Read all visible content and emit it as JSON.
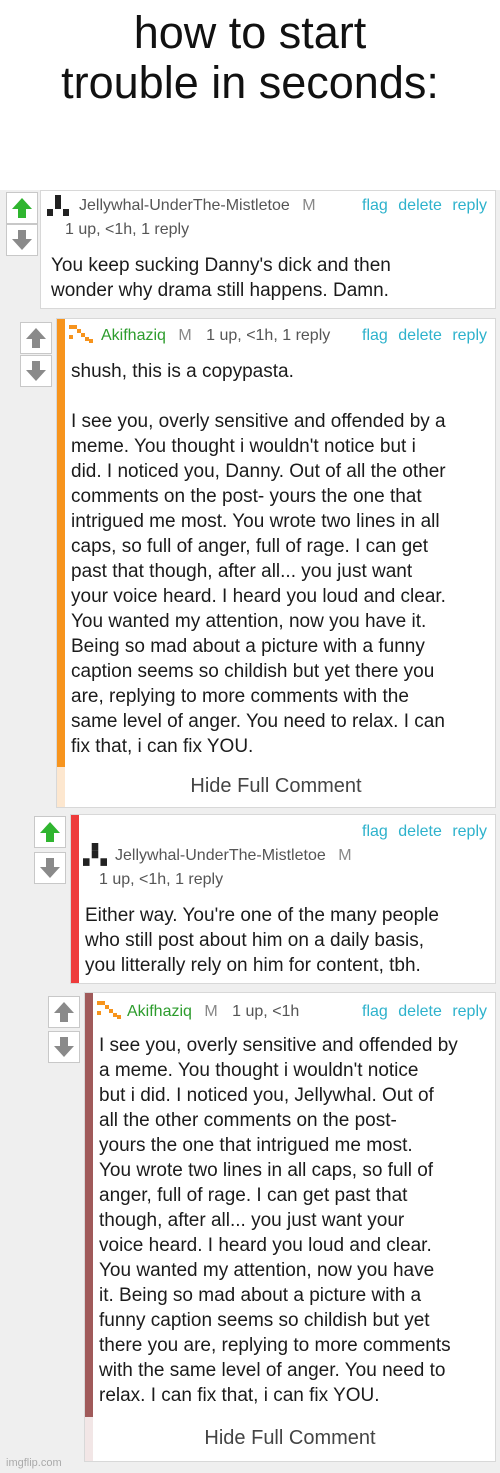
{
  "meme": {
    "title_line1": "how to start",
    "title_line2": "trouble in seconds:"
  },
  "actions": {
    "flag": "flag",
    "delete": "delete",
    "reply": "reply"
  },
  "comments": [
    {
      "username": "Jellywhal-UnderThe-Mistletoe",
      "badge": "M",
      "meta": "1 up, <1h, 1 reply",
      "body": "You keep sucking Danny's dick and then\nwonder why drama still happens. Damn."
    },
    {
      "username": "Akifhaziq",
      "badge": "M",
      "meta": "1 up, <1h, 1 reply",
      "body": "shush, this is a copypasta.\n\nI see you, overly sensitive and offended by a\nmeme. You thought i wouldn't notice but i\ndid. I noticed you, Danny. Out of all the other\ncomments on the post- yours the one that\nintrigued me most. You wrote two lines in all\ncaps, so full of anger, full of rage. I can get\npast that though, after all... you just want\nyour voice heard. I heard you loud and clear.\nYou wanted my attention, now you have it.\nBeing so mad about a picture with a funny\ncaption seems so childish but yet there you\nare, replying to more comments with the\nsame level of anger. You need to relax. I can\nfix that, i can fix YOU.",
      "hide_label": "Hide Full Comment",
      "bar_color": "#f7941d"
    },
    {
      "username": "Jellywhal-UnderThe-Mistletoe",
      "badge": "M",
      "meta": "1 up, <1h, 1 reply",
      "body": "Either way. You're one of the many people\nwho still post about him on a daily basis,\nyou litterally rely on him for content, tbh.",
      "bar_color": "#ee3b3b"
    },
    {
      "username": "Akifhaziq",
      "badge": "M",
      "meta": "1 up, <1h",
      "body": "I see you, overly sensitive and offended by\na meme. You thought i wouldn't notice\nbut i did. I noticed you, Jellywhal. Out of\nall the other comments on the post-\nyours the one that intrigued me most.\nYou wrote two lines in all caps, so full of\nanger, full of rage. I can get past that\nthough, after all... you just want your\nvoice heard. I heard you loud and clear.\nYou wanted my attention, now you have\nit. Being so mad about a picture with a\nfunny caption seems so childish but yet\nthere you are, replying to more comments\nwith the same level of anger. You need to\nrelax. I can fix that, i can fix YOU.",
      "hide_label": "Hide Full Comment",
      "bar_color": "#a05a5a"
    }
  ],
  "watermark": "imgflip.com",
  "colors": {
    "upvote_active": "#2fb52f",
    "arrow_gray": "#8a8a8a",
    "action_link": "#2db2cc",
    "username_green": "#2c9c2c"
  }
}
